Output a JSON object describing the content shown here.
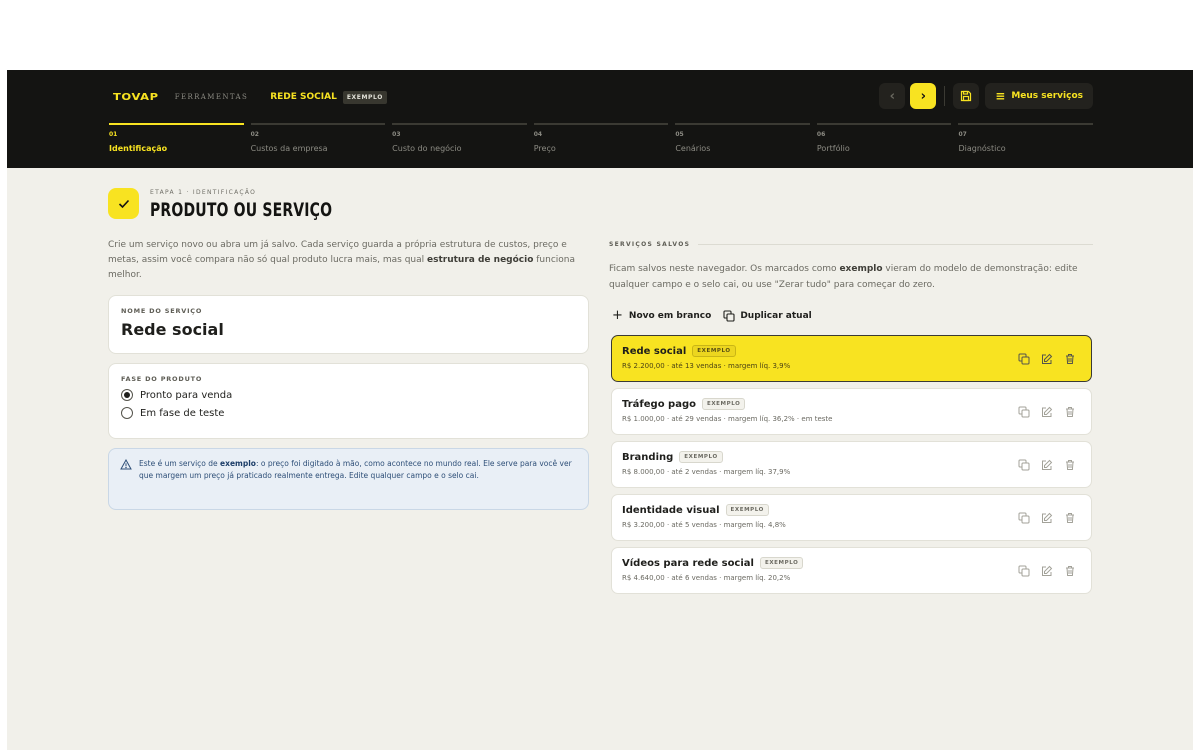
{
  "header": {
    "logo": "TOVAP",
    "logo_sub": "FERRAMENTAS",
    "current_service": "REDE SOCIAL",
    "current_badge": "EXEMPLO",
    "services_button": "Meus serviços"
  },
  "steps": [
    {
      "num": "01",
      "label": "Identificação",
      "active": true
    },
    {
      "num": "02",
      "label": "Custos da empresa",
      "active": false
    },
    {
      "num": "03",
      "label": "Custo do negócio",
      "active": false
    },
    {
      "num": "04",
      "label": "Preço",
      "active": false
    },
    {
      "num": "05",
      "label": "Cenários",
      "active": false
    },
    {
      "num": "06",
      "label": "Portfólio",
      "active": false
    },
    {
      "num": "07",
      "label": "Diagnóstico",
      "active": false
    }
  ],
  "page": {
    "eyebrow": "ETAPA 1 · IDENTIFICAÇÃO",
    "title": "PRODUTO OU SERVIÇO",
    "intro_part1": "Crie um serviço novo ou abra um já salvo. Cada serviço guarda a própria estrutura de custos, preço e metas, assim você compara não só qual produto lucra mais, mas qual ",
    "intro_bold": "estrutura de negócio",
    "intro_part2": " funciona melhor."
  },
  "name_field": {
    "label": "NOME DO SERVIÇO",
    "value": "Rede social"
  },
  "phase": {
    "label": "FASE DO PRODUTO",
    "options": [
      {
        "label": "Pronto para venda",
        "checked": true
      },
      {
        "label": "Em fase de teste",
        "checked": false
      }
    ]
  },
  "info": {
    "part1": "Este é um serviço de ",
    "bold": "exemplo",
    "part2": ": o preço foi digitado à mão, como acontece no mundo real. Ele serve para você ver que margem um preço já praticado realmente entrega. Edite qualquer campo e o selo cai."
  },
  "saved": {
    "title": "SERVIÇOS SALVOS",
    "desc_part1": "Ficam salvos neste navegador. Os marcados como ",
    "desc_bold": "exemplo",
    "desc_part2": " vieram do modelo de demonstração: edite qualquer campo e o selo cai, ou use \"Zerar tudo\" para começar do zero.",
    "new_label": "Novo em branco",
    "duplicate_label": "Duplicar atual",
    "items": [
      {
        "name": "Rede social",
        "badge": "EXEMPLO",
        "meta": "R$ 2.200,00 · até 13 vendas · margem líq. 3,9%",
        "selected": true
      },
      {
        "name": "Tráfego pago",
        "badge": "EXEMPLO",
        "meta": "R$ 1.000,00 · até 29 vendas · margem líq. 36,2% · em teste",
        "selected": false
      },
      {
        "name": "Branding",
        "badge": "EXEMPLO",
        "meta": "R$ 8.000,00 · até 2 vendas · margem líq. 37,9%",
        "selected": false
      },
      {
        "name": "Identidade visual",
        "badge": "EXEMPLO",
        "meta": "R$ 3.200,00 · até 5 vendas · margem líq. 4,8%",
        "selected": false
      },
      {
        "name": "Vídeos para rede social",
        "badge": "EXEMPLO",
        "meta": "R$ 4.640,00 · até 6 vendas · margem líq. 20,2%",
        "selected": false
      }
    ]
  },
  "colors": {
    "accent": "#f8e321",
    "topbar": "#141412",
    "background": "#f1f0ea",
    "info_bg": "#e9eff6"
  }
}
